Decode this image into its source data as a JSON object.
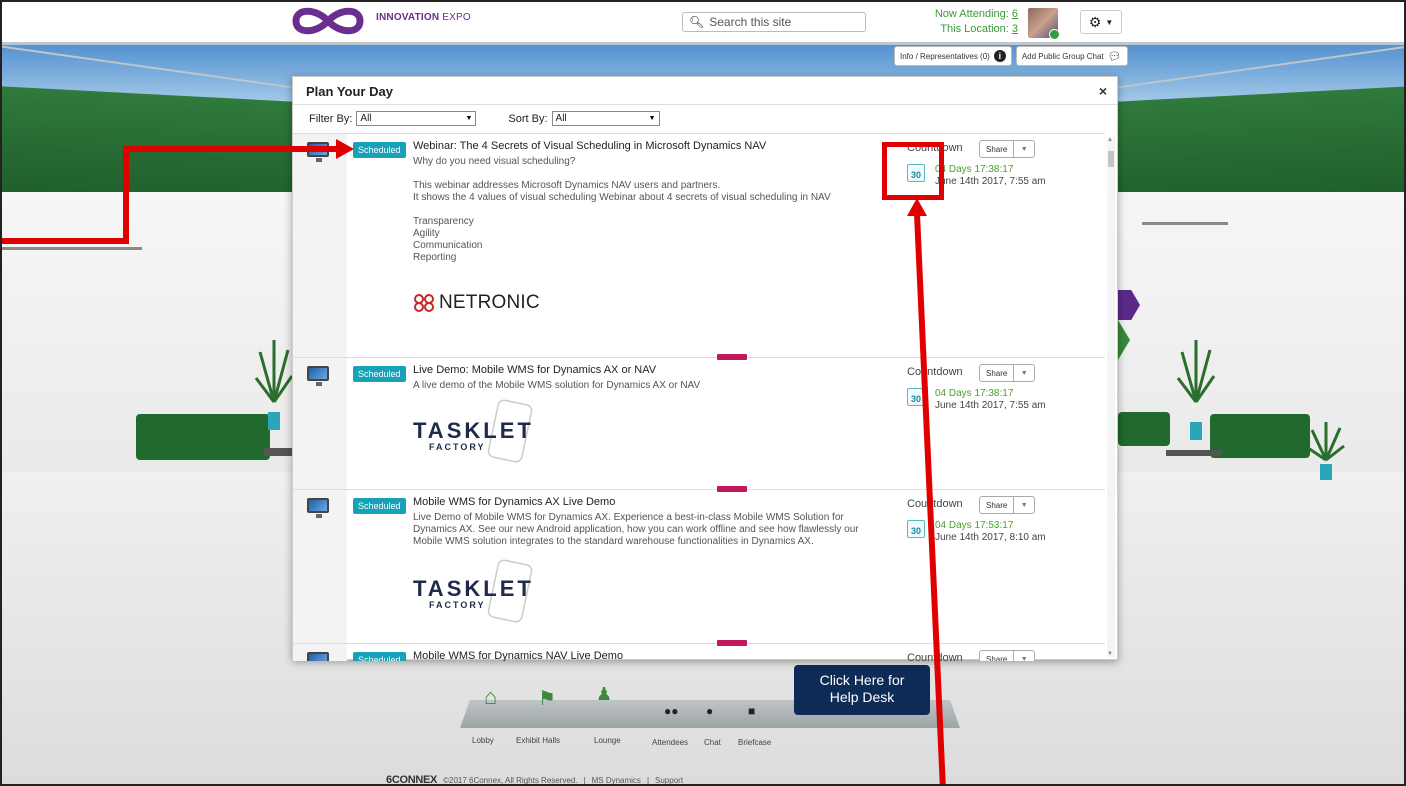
{
  "header": {
    "brand_bold": "INNOVATION",
    "brand_rest": "EXPO",
    "search_placeholder": "Search this site",
    "now_attending_label": "Now Attending:",
    "now_attending_count": "6",
    "this_location_label": "This Location:",
    "this_location_count": "3"
  },
  "info_bar": {
    "info_label": "Info / Representatives (0)",
    "chat_label": "Add Public Group Chat"
  },
  "modal": {
    "title": "Plan Your Day",
    "close": "×",
    "filter_label": "Filter By:",
    "filter_value": "All",
    "sort_label": "Sort By:",
    "sort_value": "All"
  },
  "sessions": [
    {
      "badge": "Scheduled",
      "title": "Webinar: The 4 Secrets of Visual Scheduling in Microsoft Dynamics NAV",
      "description": "Why do you need visual scheduling?\n\nThis webinar addresses Microsoft Dynamics NAV users and partners.\nIt shows the 4 values of visual scheduling Webinar about 4 secrets of visual scheduling in NAV\n\nTransparency\nAgility\nCommunication\nReporting",
      "countdown_label": "Countdown",
      "share_label": "Share",
      "calendar_day": "30",
      "days_prefix": "04 Days",
      "time": "17:38:17",
      "date": "June 14th 2017, 7:55 am",
      "sponsor": "NETRONIC"
    },
    {
      "badge": "Scheduled",
      "title": "Live Demo: Mobile WMS for Dynamics AX or NAV",
      "description": "A live demo of the Mobile WMS solution for Dynamics AX or NAV",
      "countdown_label": "Countdown",
      "share_label": "Share",
      "calendar_day": "30",
      "days_prefix": "04 Days",
      "time": "17:38:17",
      "date": "June 14th 2017, 7:55 am",
      "sponsor_line1": "TASKLET",
      "sponsor_line2": "FACTORY"
    },
    {
      "badge": "Scheduled",
      "title": "Mobile WMS for Dynamics AX Live Demo",
      "description": "Live Demo of Mobile WMS for Dynamics AX. Experience a best-in-class Mobile WMS Solution for\nDynamics AX. See our new Android application, how you can work offline and see how flawlessly our\nMobile WMS solution integrates to the standard warehouse functionalities in Dynamics AX.",
      "countdown_label": "Countdown",
      "share_label": "Share",
      "calendar_day": "30",
      "days_prefix": "04 Days",
      "time": "17:53:17",
      "date": "June 14th 2017, 8:10 am",
      "sponsor_line1": "TASKLET",
      "sponsor_line2": "FACTORY"
    },
    {
      "badge": "Scheduled",
      "title": "Mobile WMS for Dynamics NAV Live Demo",
      "countdown_label": "Countdown",
      "share_label": "Share"
    }
  ],
  "nav": {
    "lobby": "Lobby",
    "exhibit_halls": "Exhibit Halls",
    "lounge": "Lounge",
    "attendees": "Attendees",
    "chat": "Chat",
    "briefcase": "Briefcase"
  },
  "helpdesk": {
    "line1": "Click Here for",
    "line2": "Help Desk"
  },
  "footer": {
    "brand": "6CONNEX",
    "copyright": "©2017 6Connex, All Rights Reserved.",
    "sep": "|",
    "link1": "MS Dynamics",
    "link2": "Support"
  },
  "colors": {
    "accent_teal": "#17a2b8",
    "countdown_green": "#4aa02c",
    "annotation_red": "#e10000",
    "helpdesk_navy": "#0e2b57",
    "brand_purple": "#6a2e8f"
  }
}
